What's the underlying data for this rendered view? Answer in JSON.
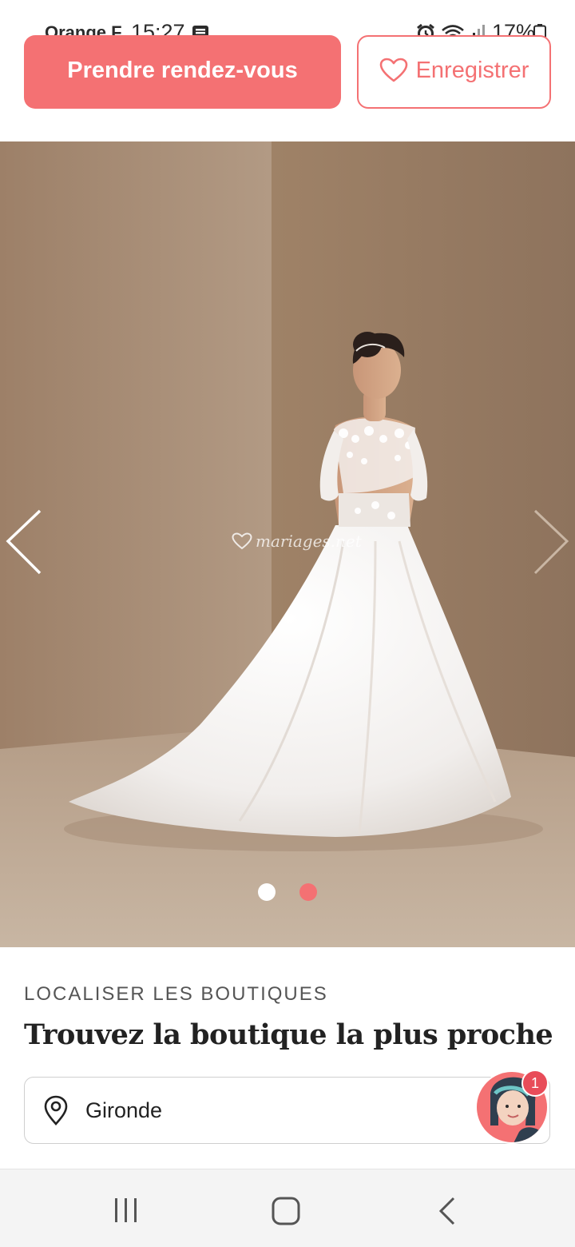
{
  "status_bar": {
    "carrier": "Orange F",
    "time": "15:27",
    "battery": "17%"
  },
  "actions": {
    "primary_label": "Prendre rendez-vous",
    "secondary_label": "Enregistrer"
  },
  "carousel": {
    "watermark": "mariages.net",
    "slide_count": 2,
    "active_index": 1,
    "colors": {
      "inactive_dot": "#ffffff",
      "active_dot": "#f47173"
    }
  },
  "store_locator": {
    "eyebrow": "LOCALISER LES BOUTIQUES",
    "title": "Trouvez la boutique la plus proche",
    "location_value": "Gironde"
  },
  "chat": {
    "badge_count": "1"
  },
  "theme": {
    "accent": "#f47173",
    "text": "#222222"
  }
}
